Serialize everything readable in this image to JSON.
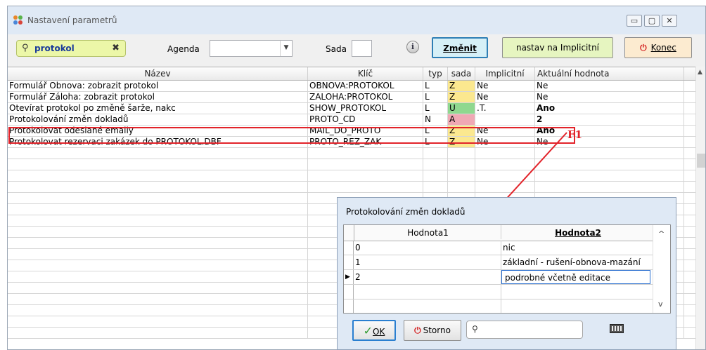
{
  "window": {
    "title": "Nastavení parametrů"
  },
  "toolbar": {
    "search_value": "protokol",
    "agenda_label": "Agenda",
    "agenda_value": "",
    "sada_label": "Sada",
    "sada_value": "",
    "change_button": "Změnit",
    "default_button": "nastav na Implicitní",
    "exit_button": "Konec"
  },
  "grid": {
    "columns": [
      "Název",
      "Klíč",
      "typ",
      "sada",
      "Implicitní",
      "Aktuální hodnota"
    ],
    "rows": [
      {
        "name": "Formulář Obnova: zobrazit protokol",
        "key": "OBNOVA:PROTOKOL",
        "type": "L",
        "set": "Z",
        "default": "Ne",
        "current": "Ne"
      },
      {
        "name": "Formulář Záloha: zobrazit protokol",
        "key": "ZALOHA:PROTOKOL",
        "type": "L",
        "set": "Z",
        "default": "Ne",
        "current": "Ne"
      },
      {
        "name": "Otevírat protokol po změně šarže, nakc",
        "key": "SHOW_PROTOKOL",
        "type": "L",
        "set": "U",
        "default": ".T.",
        "current": "Ano"
      },
      {
        "name": "Protokolování změn dokladů",
        "key": "PROTO_CD",
        "type": "N",
        "set": "A",
        "default": "",
        "current": "2"
      },
      {
        "name": "Protokolovat odeslané emaily",
        "key": "MAIL_DO_PROTO",
        "type": "L",
        "set": "Z",
        "default": "Ne",
        "current": "Ano"
      },
      {
        "name": "Protokolovat rezervaci zakázek do PROTOKOL.DBF",
        "key": "PROTO_REZ_ZAK",
        "type": "L",
        "set": "Z",
        "default": "Ne",
        "current": "Ne"
      }
    ]
  },
  "annotation": {
    "label": "F1"
  },
  "dialog": {
    "title": "Protokolování změn dokladů",
    "columns": [
      "Hodnota1",
      "Hodnota2"
    ],
    "rows": [
      {
        "v1": "0",
        "v2": "nic"
      },
      {
        "v1": "1",
        "v2": "základní - rušení-obnova-mazání"
      },
      {
        "v1": "2",
        "v2": "podrobné včetně editace"
      }
    ],
    "ok_button": "OK",
    "cancel_button": "Storno",
    "search_value": ""
  },
  "colors": {
    "set_Z": "#fbe88f",
    "set_U": "#8fd88f",
    "set_A": "#f0a8b4",
    "annotation": "#e2232a",
    "search_bg": "#ecf7a8",
    "change_button_bg": "#d6f0f7",
    "default_button_bg": "#e6f5c0",
    "exit_button_bg": "#fcebd0"
  },
  "icons": {
    "app": "app-icon",
    "search": "search-icon",
    "clear": "clear-icon",
    "dropdown": "chevron-down-icon",
    "info": "info-icon",
    "exit": "power-icon",
    "ok": "checkmark-icon",
    "cancel": "power-icon",
    "calculator": "calculator-icon"
  }
}
